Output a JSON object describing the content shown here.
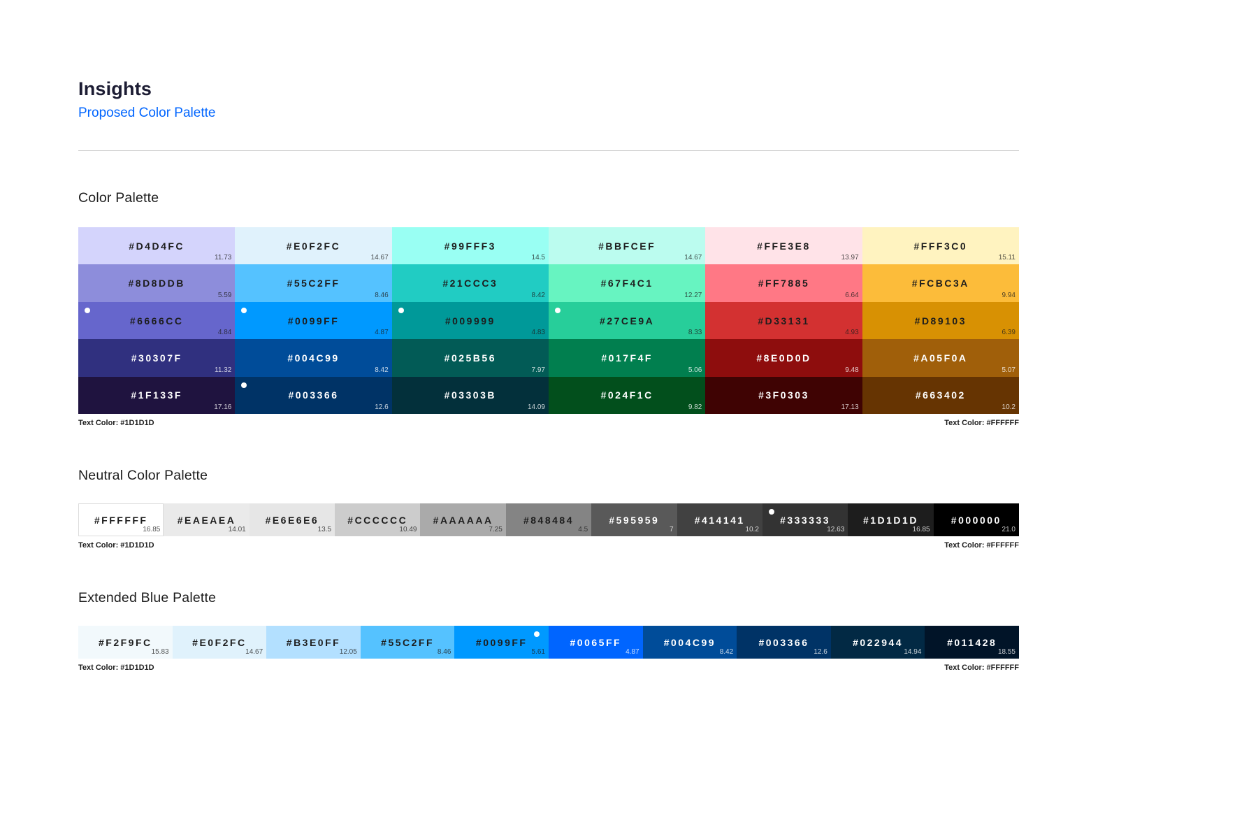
{
  "theme": {
    "title_color": "#1C1C33",
    "subtitle_color": "#0065FF",
    "heading_color": "#1D1D1D",
    "divider_color": "#CCCCCC"
  },
  "header": {
    "title": "Insights",
    "subtitle": "Proposed Color Palette"
  },
  "palettes": [
    {
      "title": "Color Palette",
      "columns": 6,
      "caption_left": "Text Color: #1D1D1D",
      "caption_right": "Text Color: #FFFFFF",
      "swatches": [
        {
          "hex": "#D4D4FC",
          "ratio": "11.73",
          "text": "dark"
        },
        {
          "hex": "#E0F2FC",
          "ratio": "14.67",
          "text": "dark"
        },
        {
          "hex": "#99FFF3",
          "ratio": "14.5",
          "text": "dark"
        },
        {
          "hex": "#BBFCEF",
          "ratio": "14.67",
          "text": "dark"
        },
        {
          "hex": "#FFE3E8",
          "ratio": "13.97",
          "text": "dark"
        },
        {
          "hex": "#FFF3C0",
          "ratio": "15.11",
          "text": "dark"
        },
        {
          "hex": "#8D8DDB",
          "ratio": "5.59",
          "text": "dark"
        },
        {
          "hex": "#55C2FF",
          "ratio": "8.46",
          "text": "dark"
        },
        {
          "hex": "#21CCC3",
          "ratio": "8.42",
          "text": "dark"
        },
        {
          "hex": "#67F4C1",
          "ratio": "12.27",
          "text": "dark"
        },
        {
          "hex": "#FF7885",
          "ratio": "6.64",
          "text": "dark"
        },
        {
          "hex": "#FCBC3A",
          "ratio": "9.94",
          "text": "dark"
        },
        {
          "hex": "#6666CC",
          "ratio": "4.84",
          "text": "dark",
          "dot": "left"
        },
        {
          "hex": "#0099FF",
          "ratio": "4.87",
          "text": "dark",
          "dot": "left"
        },
        {
          "hex": "#009999",
          "ratio": "4.83",
          "text": "dark",
          "dot": "left"
        },
        {
          "hex": "#27CE9A",
          "ratio": "8.33",
          "text": "dark",
          "dot": "left"
        },
        {
          "hex": "#D33131",
          "ratio": "4.93",
          "text": "dark"
        },
        {
          "hex": "#D89103",
          "ratio": "6.39",
          "text": "dark"
        },
        {
          "hex": "#30307F",
          "ratio": "11.32",
          "text": "light"
        },
        {
          "hex": "#004C99",
          "ratio": "8.42",
          "text": "light"
        },
        {
          "hex": "#025B56",
          "ratio": "7.97",
          "text": "light"
        },
        {
          "hex": "#017F4F",
          "ratio": "5.06",
          "text": "light"
        },
        {
          "hex": "#8E0D0D",
          "ratio": "9.48",
          "text": "light"
        },
        {
          "hex": "#A05F0A",
          "ratio": "5.07",
          "text": "light"
        },
        {
          "hex": "#1F133F",
          "ratio": "17.16",
          "text": "light"
        },
        {
          "hex": "#003366",
          "ratio": "12.6",
          "text": "light",
          "dot": "left"
        },
        {
          "hex": "#03303B",
          "ratio": "14.09",
          "text": "light"
        },
        {
          "hex": "#024F1C",
          "ratio": "9.82",
          "text": "light"
        },
        {
          "hex": "#3F0303",
          "ratio": "17.13",
          "text": "light"
        },
        {
          "hex": "#663402",
          "ratio": "10.2",
          "text": "light"
        }
      ]
    },
    {
      "title": "Neutral Color Palette",
      "columns": 11,
      "caption_left": "Text Color: #1D1D1D",
      "caption_right": "Text Color: #FFFFFF",
      "swatches": [
        {
          "hex": "#FFFFFF",
          "ratio": "16.85",
          "text": "dark"
        },
        {
          "hex": "#EAEAEA",
          "ratio": "14.01",
          "text": "dark"
        },
        {
          "hex": "#E6E6E6",
          "ratio": "13.5",
          "text": "dark"
        },
        {
          "hex": "#CCCCCC",
          "ratio": "10.49",
          "text": "dark"
        },
        {
          "hex": "#AAAAAA",
          "ratio": "7.25",
          "text": "dark"
        },
        {
          "hex": "#848484",
          "ratio": "4.5",
          "text": "dark"
        },
        {
          "hex": "#595959",
          "ratio": "7",
          "text": "light"
        },
        {
          "hex": "#414141",
          "ratio": "10.2",
          "text": "light"
        },
        {
          "hex": "#333333",
          "ratio": "12.63",
          "text": "light",
          "dot": "left"
        },
        {
          "hex": "#1D1D1D",
          "ratio": "16.85",
          "text": "light"
        },
        {
          "hex": "#000000",
          "ratio": "21.0",
          "text": "light"
        }
      ]
    },
    {
      "title": "Extended Blue Palette",
      "columns": 10,
      "caption_left": "Text Color: #1D1D1D",
      "caption_right": "Text Color: #FFFFFF",
      "swatches": [
        {
          "hex": "#F2F9FC",
          "ratio": "15.83",
          "text": "dark"
        },
        {
          "hex": "#E0F2FC",
          "ratio": "14.67",
          "text": "dark"
        },
        {
          "hex": "#B3E0FF",
          "ratio": "12.05",
          "text": "dark"
        },
        {
          "hex": "#55C2FF",
          "ratio": "8.46",
          "text": "dark"
        },
        {
          "hex": "#0099FF",
          "ratio": "5.61",
          "text": "dark",
          "dot": "right"
        },
        {
          "hex": "#0065FF",
          "ratio": "4.87",
          "text": "light"
        },
        {
          "hex": "#004C99",
          "ratio": "8.42",
          "text": "light"
        },
        {
          "hex": "#003366",
          "ratio": "12.6",
          "text": "light"
        },
        {
          "hex": "#022944",
          "ratio": "14.94",
          "text": "light"
        },
        {
          "hex": "#011428",
          "ratio": "18.55",
          "text": "light"
        }
      ]
    }
  ]
}
